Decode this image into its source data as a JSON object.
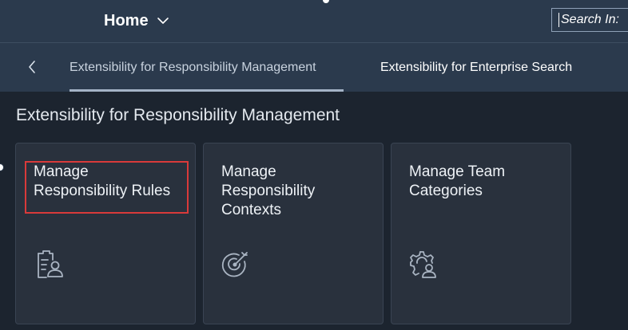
{
  "header": {
    "home_label": "Home",
    "search_placeholder": "Search In:",
    "chevron_icon": "chevron-down-icon"
  },
  "tabs": {
    "back_icon": "chevron-left-icon",
    "items": [
      {
        "label": "Extensibility for Responsibility Management",
        "selected": true
      },
      {
        "label": "Extensibility for Enterprise Search",
        "selected": false
      }
    ]
  },
  "section": {
    "title": "Extensibility for Responsibility Management"
  },
  "tiles": [
    {
      "title": "Manage Responsibility Rules",
      "icon": "clipboard-person-icon",
      "highlighted": true
    },
    {
      "title": "Manage Responsibility Contexts",
      "icon": "target-icon",
      "highlighted": false
    },
    {
      "title": "Manage Team Categories",
      "icon": "gear-person-icon",
      "highlighted": false
    }
  ],
  "colors": {
    "shell": "#2b3a4d",
    "background": "#1c242f",
    "tile": "#29313d",
    "highlight": "#d93a3a",
    "icon": "#a9b4c2"
  }
}
